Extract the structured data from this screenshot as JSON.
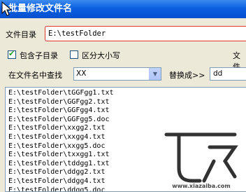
{
  "window": {
    "title": "批量修改文件名"
  },
  "directory": {
    "label": "文件目录",
    "value": "E:\\testFolder"
  },
  "options": {
    "include_subdirs_label": "包含子目录",
    "include_subdirs_checked": true,
    "case_sensitive_label": "区分大小写",
    "case_sensitive_checked": false,
    "right_label_partial": "文件"
  },
  "find": {
    "label": "在文件名中查找",
    "value": "XX"
  },
  "replace": {
    "label": "替换成>>",
    "value": "dd"
  },
  "file_list": [
    "E:\\testFolder\\tGGFgg1.txt",
    "E:\\testFolder\\GGFgg2.txt",
    "E:\\testFolder\\GGFgg4.txt",
    "E:\\testFolder\\GGFgg5.doc",
    "E:\\testFolder\\xxgg2.txt",
    "E:\\testFolder\\xxgg4.txt",
    "E:\\testFolder\\xxgg5.doc",
    "E:\\testFolder\\txxgg1.txt",
    "E:\\testFolder\\tddgg1.txt",
    "E:\\testFolder\\ddgg2.txt",
    "E:\\testFolder\\ddgg4.txt",
    "E:\\testFolder\\ddgg5.doc"
  ],
  "watermark": {
    "text": "下载吧",
    "subtext": "www.xiazaiba.com"
  },
  "icons": [
    "cursor-icon",
    "checkmark-icon",
    "dropdown-arrow-icon"
  ],
  "colors": {
    "title_bar": "#0a5fe0",
    "highlight_border": "#e0342a",
    "checkmark": "#21a121"
  }
}
